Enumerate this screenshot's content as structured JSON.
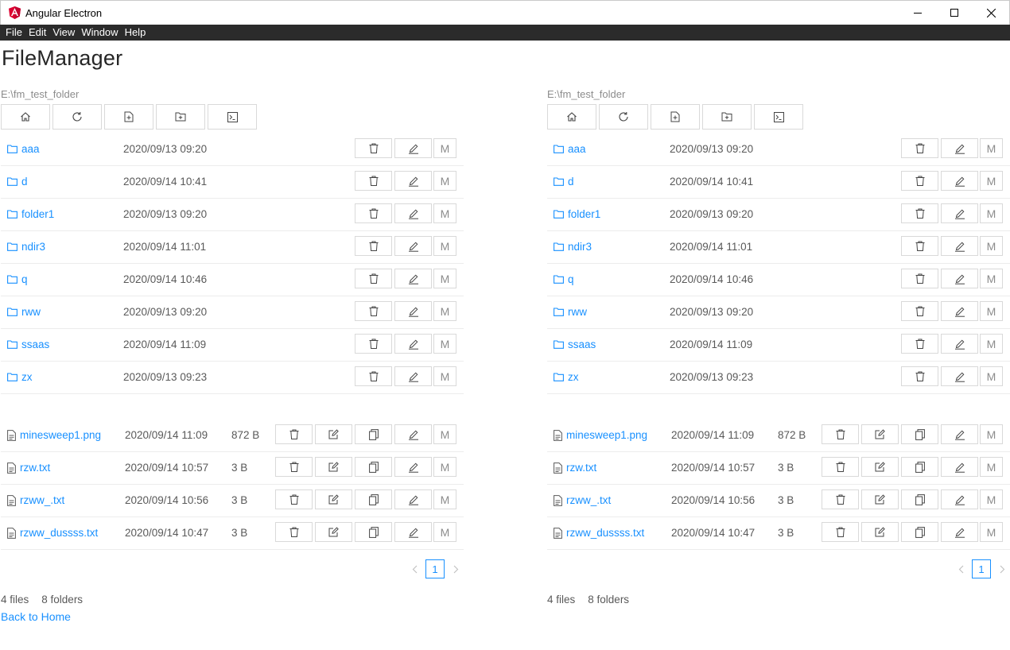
{
  "window": {
    "title": "Angular Electron",
    "icon": "angular-logo-icon"
  },
  "menu": [
    "File",
    "Edit",
    "View",
    "Window",
    "Help"
  ],
  "page_title": "FileManager",
  "panels": [
    {
      "path": "E:\\fm_test_folder",
      "toolbar": [
        "home-icon",
        "refresh-icon",
        "new-file-icon",
        "new-folder-icon",
        "terminal-icon"
      ],
      "folders": [
        {
          "name": "aaa",
          "date": "2020/09/13 09:20"
        },
        {
          "name": "d",
          "date": "2020/09/14 10:41"
        },
        {
          "name": "folder1",
          "date": "2020/09/13 09:20"
        },
        {
          "name": "ndir3",
          "date": "2020/09/14 11:01"
        },
        {
          "name": "q",
          "date": "2020/09/14 10:46"
        },
        {
          "name": "rww",
          "date": "2020/09/13 09:20"
        },
        {
          "name": "ssaas",
          "date": "2020/09/14 11:09"
        },
        {
          "name": "zx",
          "date": "2020/09/13 09:23"
        }
      ],
      "files": [
        {
          "name": "minesweep1.png",
          "date": "2020/09/14 11:09",
          "size": "872 B"
        },
        {
          "name": "rzw.txt",
          "date": "2020/09/14 10:57",
          "size": "3 B"
        },
        {
          "name": "rzww_.txt",
          "date": "2020/09/14 10:56",
          "size": "3 B"
        },
        {
          "name": "rzww_dussss.txt",
          "date": "2020/09/14 10:47",
          "size": "3 B"
        }
      ],
      "page": "1",
      "files_count": "4 files",
      "folders_count": "8 folders"
    },
    {
      "path": "E:\\fm_test_folder",
      "toolbar": [
        "home-icon",
        "refresh-icon",
        "new-file-icon",
        "new-folder-icon",
        "terminal-icon"
      ],
      "folders": [
        {
          "name": "aaa",
          "date": "2020/09/13 09:20"
        },
        {
          "name": "d",
          "date": "2020/09/14 10:41"
        },
        {
          "name": "folder1",
          "date": "2020/09/13 09:20"
        },
        {
          "name": "ndir3",
          "date": "2020/09/14 11:01"
        },
        {
          "name": "q",
          "date": "2020/09/14 10:46"
        },
        {
          "name": "rww",
          "date": "2020/09/13 09:20"
        },
        {
          "name": "ssaas",
          "date": "2020/09/14 11:09"
        },
        {
          "name": "zx",
          "date": "2020/09/13 09:23"
        }
      ],
      "files": [
        {
          "name": "minesweep1.png",
          "date": "2020/09/14 11:09",
          "size": "872 B"
        },
        {
          "name": "rzw.txt",
          "date": "2020/09/14 10:57",
          "size": "3 B"
        },
        {
          "name": "rzww_.txt",
          "date": "2020/09/14 10:56",
          "size": "3 B"
        },
        {
          "name": "rzww_dussss.txt",
          "date": "2020/09/14 10:47",
          "size": "3 B"
        }
      ],
      "page": "1",
      "files_count": "4 files",
      "folders_count": "8 folders"
    }
  ],
  "actions": {
    "move_label": "M"
  },
  "back_link": "Back to Home",
  "colors": {
    "link": "#1890ff",
    "menubar": "#2b2b2b",
    "border": "#d9d9d9"
  }
}
